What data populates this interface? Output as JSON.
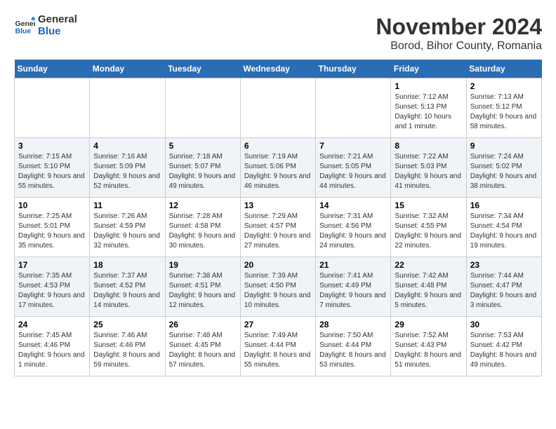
{
  "logo": {
    "text_general": "General",
    "text_blue": "Blue"
  },
  "title": "November 2024",
  "location": "Borod, Bihor County, Romania",
  "days_of_week": [
    "Sunday",
    "Monday",
    "Tuesday",
    "Wednesday",
    "Thursday",
    "Friday",
    "Saturday"
  ],
  "weeks": [
    [
      {
        "day": "",
        "info": ""
      },
      {
        "day": "",
        "info": ""
      },
      {
        "day": "",
        "info": ""
      },
      {
        "day": "",
        "info": ""
      },
      {
        "day": "",
        "info": ""
      },
      {
        "day": "1",
        "info": "Sunrise: 7:12 AM\nSunset: 5:13 PM\nDaylight: 10 hours and 1 minute."
      },
      {
        "day": "2",
        "info": "Sunrise: 7:13 AM\nSunset: 5:12 PM\nDaylight: 9 hours and 58 minutes."
      }
    ],
    [
      {
        "day": "3",
        "info": "Sunrise: 7:15 AM\nSunset: 5:10 PM\nDaylight: 9 hours and 55 minutes."
      },
      {
        "day": "4",
        "info": "Sunrise: 7:16 AM\nSunset: 5:09 PM\nDaylight: 9 hours and 52 minutes."
      },
      {
        "day": "5",
        "info": "Sunrise: 7:18 AM\nSunset: 5:07 PM\nDaylight: 9 hours and 49 minutes."
      },
      {
        "day": "6",
        "info": "Sunrise: 7:19 AM\nSunset: 5:06 PM\nDaylight: 9 hours and 46 minutes."
      },
      {
        "day": "7",
        "info": "Sunrise: 7:21 AM\nSunset: 5:05 PM\nDaylight: 9 hours and 44 minutes."
      },
      {
        "day": "8",
        "info": "Sunrise: 7:22 AM\nSunset: 5:03 PM\nDaylight: 9 hours and 41 minutes."
      },
      {
        "day": "9",
        "info": "Sunrise: 7:24 AM\nSunset: 5:02 PM\nDaylight: 9 hours and 38 minutes."
      }
    ],
    [
      {
        "day": "10",
        "info": "Sunrise: 7:25 AM\nSunset: 5:01 PM\nDaylight: 9 hours and 35 minutes."
      },
      {
        "day": "11",
        "info": "Sunrise: 7:26 AM\nSunset: 4:59 PM\nDaylight: 9 hours and 32 minutes."
      },
      {
        "day": "12",
        "info": "Sunrise: 7:28 AM\nSunset: 4:58 PM\nDaylight: 9 hours and 30 minutes."
      },
      {
        "day": "13",
        "info": "Sunrise: 7:29 AM\nSunset: 4:57 PM\nDaylight: 9 hours and 27 minutes."
      },
      {
        "day": "14",
        "info": "Sunrise: 7:31 AM\nSunset: 4:56 PM\nDaylight: 9 hours and 24 minutes."
      },
      {
        "day": "15",
        "info": "Sunrise: 7:32 AM\nSunset: 4:55 PM\nDaylight: 9 hours and 22 minutes."
      },
      {
        "day": "16",
        "info": "Sunrise: 7:34 AM\nSunset: 4:54 PM\nDaylight: 9 hours and 19 minutes."
      }
    ],
    [
      {
        "day": "17",
        "info": "Sunrise: 7:35 AM\nSunset: 4:53 PM\nDaylight: 9 hours and 17 minutes."
      },
      {
        "day": "18",
        "info": "Sunrise: 7:37 AM\nSunset: 4:52 PM\nDaylight: 9 hours and 14 minutes."
      },
      {
        "day": "19",
        "info": "Sunrise: 7:38 AM\nSunset: 4:51 PM\nDaylight: 9 hours and 12 minutes."
      },
      {
        "day": "20",
        "info": "Sunrise: 7:39 AM\nSunset: 4:50 PM\nDaylight: 9 hours and 10 minutes."
      },
      {
        "day": "21",
        "info": "Sunrise: 7:41 AM\nSunset: 4:49 PM\nDaylight: 9 hours and 7 minutes."
      },
      {
        "day": "22",
        "info": "Sunrise: 7:42 AM\nSunset: 4:48 PM\nDaylight: 9 hours and 5 minutes."
      },
      {
        "day": "23",
        "info": "Sunrise: 7:44 AM\nSunset: 4:47 PM\nDaylight: 9 hours and 3 minutes."
      }
    ],
    [
      {
        "day": "24",
        "info": "Sunrise: 7:45 AM\nSunset: 4:46 PM\nDaylight: 9 hours and 1 minute."
      },
      {
        "day": "25",
        "info": "Sunrise: 7:46 AM\nSunset: 4:46 PM\nDaylight: 8 hours and 59 minutes."
      },
      {
        "day": "26",
        "info": "Sunrise: 7:48 AM\nSunset: 4:45 PM\nDaylight: 8 hours and 57 minutes."
      },
      {
        "day": "27",
        "info": "Sunrise: 7:49 AM\nSunset: 4:44 PM\nDaylight: 8 hours and 55 minutes."
      },
      {
        "day": "28",
        "info": "Sunrise: 7:50 AM\nSunset: 4:44 PM\nDaylight: 8 hours and 53 minutes."
      },
      {
        "day": "29",
        "info": "Sunrise: 7:52 AM\nSunset: 4:43 PM\nDaylight: 8 hours and 51 minutes."
      },
      {
        "day": "30",
        "info": "Sunrise: 7:53 AM\nSunset: 4:42 PM\nDaylight: 8 hours and 49 minutes."
      }
    ]
  ]
}
